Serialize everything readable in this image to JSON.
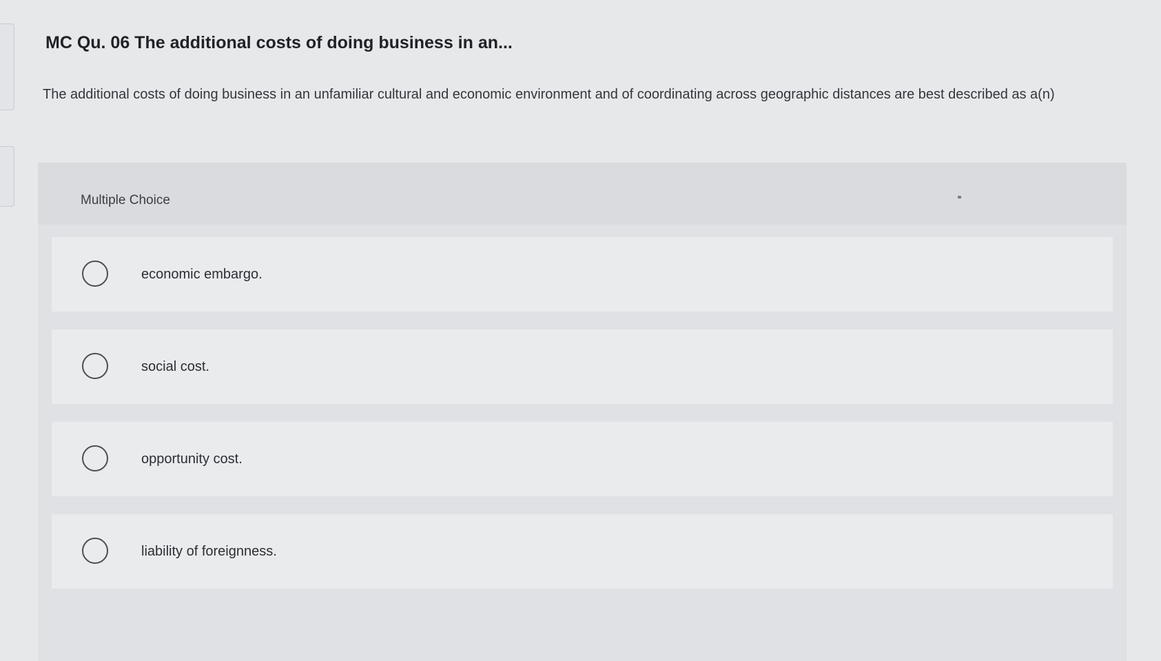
{
  "question": {
    "title": "MC Qu. 06 The additional costs of doing business in an...",
    "text": "The additional costs of doing business in an unfamiliar cultural and economic environment and of coordinating across geographic distances are best described as a(n)"
  },
  "multiple_choice": {
    "label": "Multiple Choice",
    "options": [
      {
        "label": "economic embargo.",
        "selected": false
      },
      {
        "label": "social cost.",
        "selected": false
      },
      {
        "label": "opportunity cost.",
        "selected": false
      },
      {
        "label": "liability of foreignness.",
        "selected": false
      }
    ]
  },
  "icons": {
    "option_marker": "radio-button-icon"
  },
  "colors": {
    "background": "#e6e8ea",
    "panel": "#dfe1e4",
    "option_row": "#e9ebed",
    "text": "#2b2e32"
  }
}
